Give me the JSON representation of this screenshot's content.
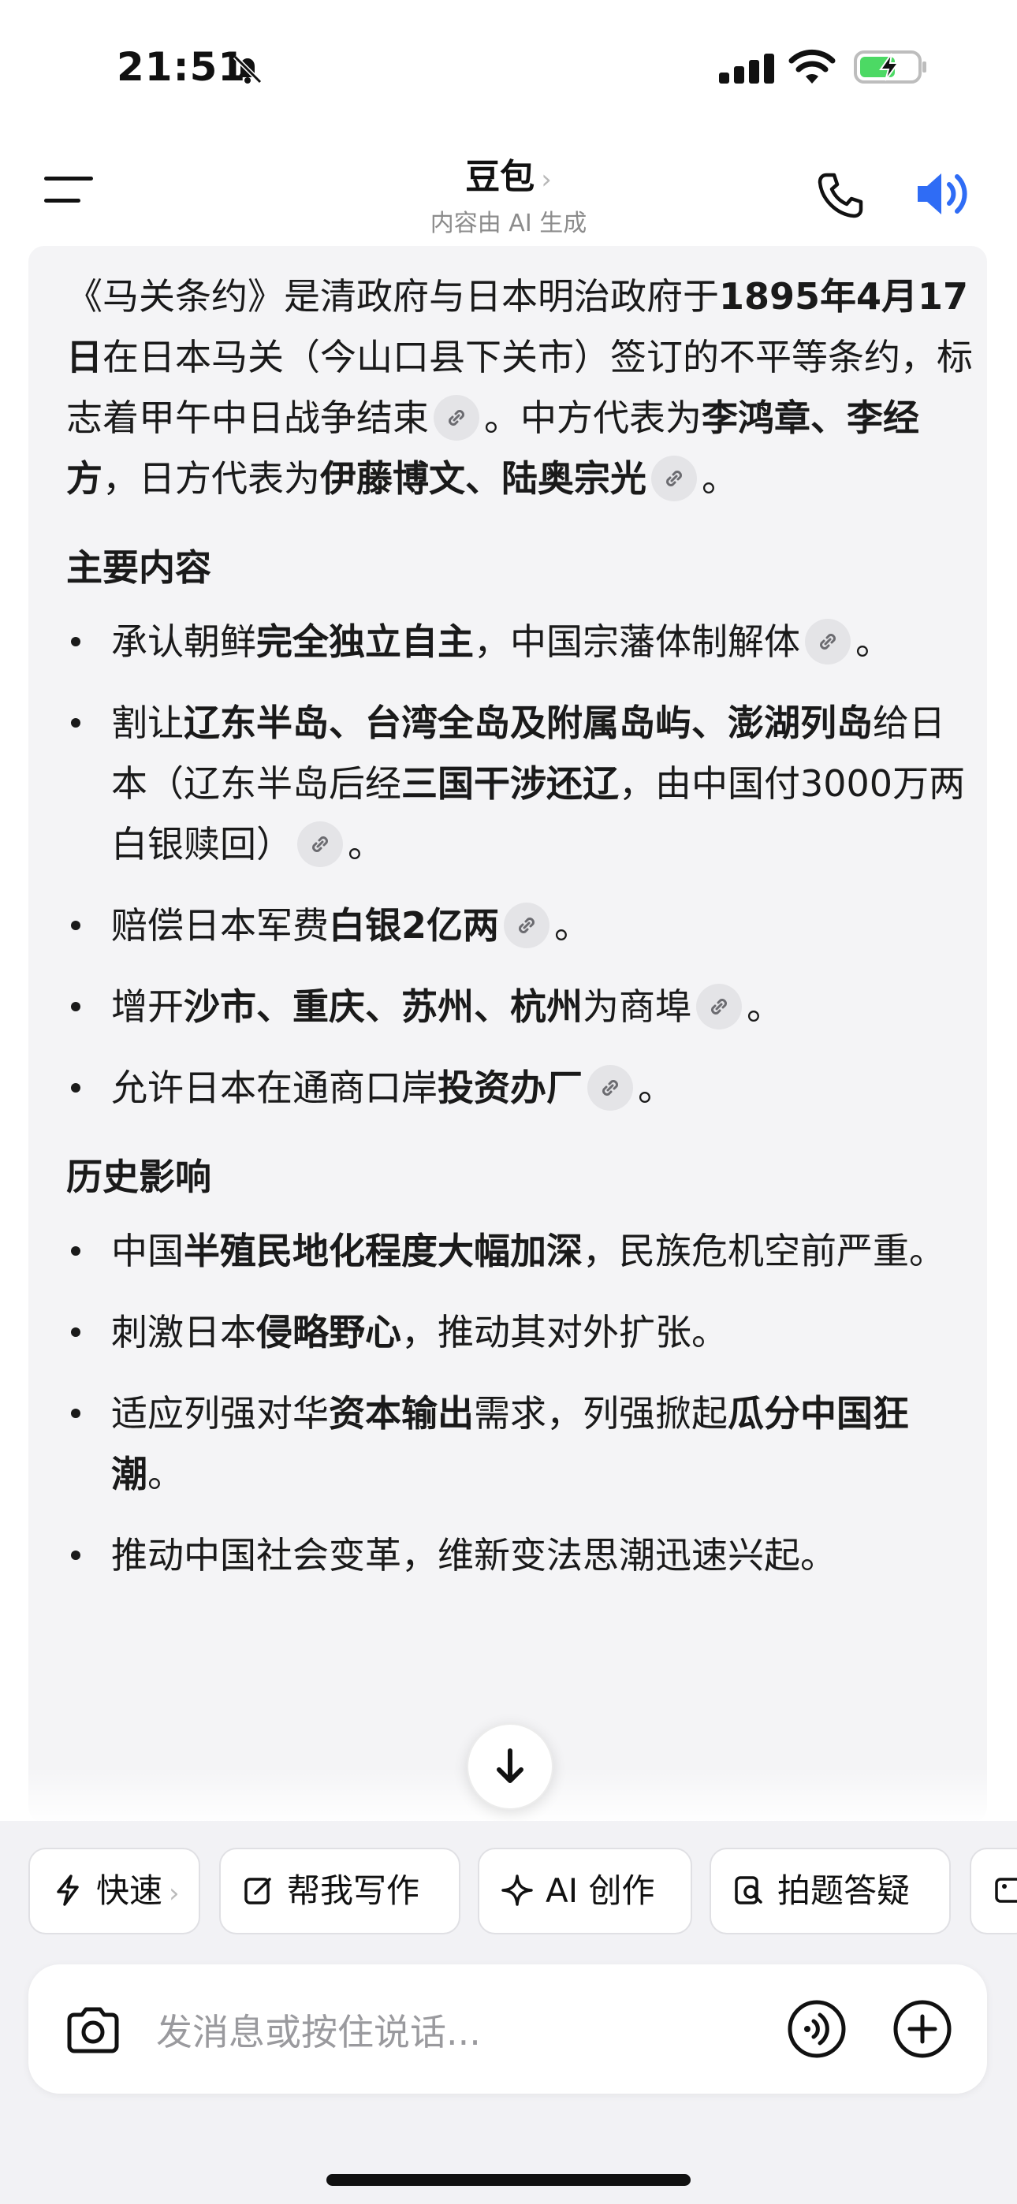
{
  "status_bar": {
    "time": "21:51",
    "icons": [
      "bell-slash-icon",
      "cellular-signal-icon",
      "wifi-icon",
      "battery-charging-icon"
    ],
    "battery_color": "#4cd964"
  },
  "header": {
    "title": "豆包",
    "title_chevron": "›",
    "subtitle": "内容由 AI 生成",
    "accent_color": "#2f6cf5"
  },
  "message": {
    "intro": {
      "t1": "《马关条约》是清政府与日本明治政府于",
      "b1": "1895年4月17日",
      "t2": "在日本马关（今山口县下关市）签订的不平等条约，标志着甲午中日战争结束",
      "t3": "。中方代表为",
      "b2": "李鸿章、李经方",
      "t4": "，日方代表为",
      "b3": "伊藤博文、陆奥宗光",
      "t5": "。"
    },
    "section1_title": "主要内容",
    "section1_items": [
      {
        "t1": "承认朝鲜",
        "b1": "完全独立自主",
        "t2": "，中国宗藩体制解体",
        "end": "。"
      },
      {
        "t1": "割让",
        "b1": "辽东半岛、台湾全岛及附属岛屿、澎湖列岛",
        "t2": "给日本（辽东半岛后经",
        "b2": "三国干涉还辽",
        "t3": "，由中国付3000万两白银赎回）",
        "end": "。"
      },
      {
        "t1": "赔偿日本军费",
        "b1": "白银2亿两",
        "end": "。"
      },
      {
        "t1": "增开",
        "b1": "沙市、重庆、苏州、杭州",
        "t2": "为商埠",
        "end": "。"
      },
      {
        "t1": "允许日本在通商口岸",
        "b1": "投资办厂",
        "end": "。"
      }
    ],
    "section2_title": "历史影响",
    "section2_items": [
      {
        "t1": "中国",
        "b1": "半殖民地化程度大幅加深",
        "t2": "，民族危机空前严重。"
      },
      {
        "t1": "刺激日本",
        "b1": "侵略野心",
        "t2": "，推动其对外扩张。"
      },
      {
        "t1": "适应列强对华",
        "b1": "资本输出",
        "t2": "需求，列强掀起",
        "b2": "瓜分中国狂潮",
        "t3": "。"
      },
      {
        "t1": "推动中国社会变革，维新变法思潮迅速兴起。"
      }
    ]
  },
  "quick_actions": [
    {
      "label": "快速",
      "icon": "lightning-icon",
      "chevron": "›"
    },
    {
      "label": "帮我写作",
      "icon": "edit-icon"
    },
    {
      "label": "AI 创作",
      "icon": "sparkle-icon"
    },
    {
      "label": "拍题答疑",
      "icon": "search-doc-icon"
    }
  ],
  "input": {
    "placeholder": "发消息或按住说话..."
  }
}
